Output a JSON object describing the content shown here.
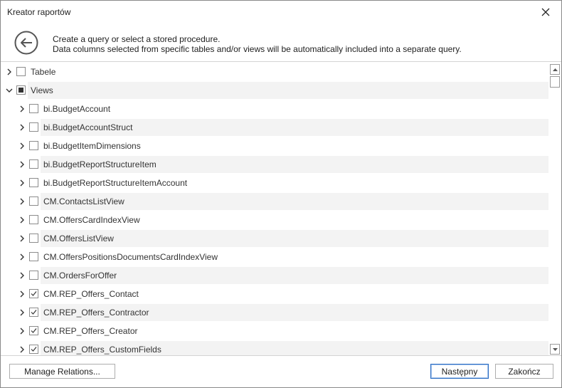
{
  "window": {
    "title": "Kreator raportów"
  },
  "header": {
    "line1": "Create a query or select a stored procedure.",
    "line2": "Data columns selected from specific tables and/or views will be automatically included into a separate query."
  },
  "tree": {
    "items": [
      {
        "label": "Tabele",
        "level": 0,
        "expanded": false,
        "check": "unchecked"
      },
      {
        "label": "Views",
        "level": 0,
        "expanded": true,
        "check": "partial"
      },
      {
        "label": "bi.BudgetAccount",
        "level": 1,
        "expanded": false,
        "check": "unchecked"
      },
      {
        "label": "bi.BudgetAccountStruct",
        "level": 1,
        "expanded": false,
        "check": "unchecked"
      },
      {
        "label": "bi.BudgetItemDimensions",
        "level": 1,
        "expanded": false,
        "check": "unchecked"
      },
      {
        "label": "bi.BudgetReportStructureItem",
        "level": 1,
        "expanded": false,
        "check": "unchecked"
      },
      {
        "label": "bi.BudgetReportStructureItemAccount",
        "level": 1,
        "expanded": false,
        "check": "unchecked"
      },
      {
        "label": "CM.ContactsListView",
        "level": 1,
        "expanded": false,
        "check": "unchecked"
      },
      {
        "label": "CM.OffersCardIndexView",
        "level": 1,
        "expanded": false,
        "check": "unchecked"
      },
      {
        "label": "CM.OffersListView",
        "level": 1,
        "expanded": false,
        "check": "unchecked"
      },
      {
        "label": "CM.OffersPositionsDocumentsCardIndexView",
        "level": 1,
        "expanded": false,
        "check": "unchecked"
      },
      {
        "label": "CM.OrdersForOffer",
        "level": 1,
        "expanded": false,
        "check": "unchecked"
      },
      {
        "label": "CM.REP_Offers_Contact",
        "level": 1,
        "expanded": false,
        "check": "checked"
      },
      {
        "label": "CM.REP_Offers_Contractor",
        "level": 1,
        "expanded": false,
        "check": "checked"
      },
      {
        "label": "CM.REP_Offers_Creator",
        "level": 1,
        "expanded": false,
        "check": "checked"
      },
      {
        "label": "CM.REP_Offers_CustomFields",
        "level": 1,
        "expanded": false,
        "check": "checked"
      }
    ]
  },
  "footer": {
    "manage_relations": "Manage Relations...",
    "next": "Następny",
    "finish": "Zakończ"
  },
  "colors": {
    "row_alt": "#f3f3f3",
    "primary_border": "#2a6cc2"
  }
}
